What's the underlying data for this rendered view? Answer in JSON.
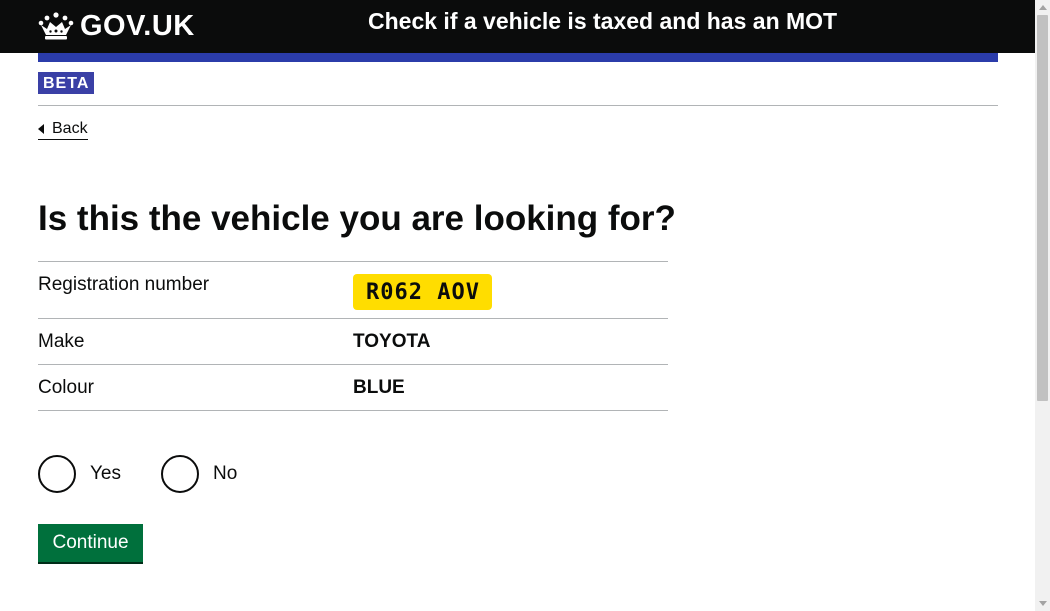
{
  "header": {
    "logo_text": "GOV.UK",
    "service_name": "Check if a vehicle is taxed and has an MOT",
    "colors": {
      "header_bg": "#0b0c0c",
      "accent_bar": "#2b3caa"
    }
  },
  "phase_banner": {
    "tag": "BETA",
    "tag_color": "#3a40a6"
  },
  "back_link": {
    "label": "Back"
  },
  "page": {
    "title": "Is this the vehicle you are looking for?"
  },
  "summary": {
    "rows": [
      {
        "key": "Registration number",
        "value": "R062 AOV"
      },
      {
        "key": "Make",
        "value": "TOYOTA"
      },
      {
        "key": "Colour",
        "value": "BLUE"
      }
    ],
    "plate_color": "#ffdd00"
  },
  "radios": {
    "options": [
      {
        "label": "Yes",
        "checked": false
      },
      {
        "label": "No",
        "checked": false
      }
    ]
  },
  "actions": {
    "continue_label": "Continue",
    "button_color": "#00703c"
  },
  "icons": {
    "logo": "crown-icon",
    "back": "chevron-left-icon"
  }
}
